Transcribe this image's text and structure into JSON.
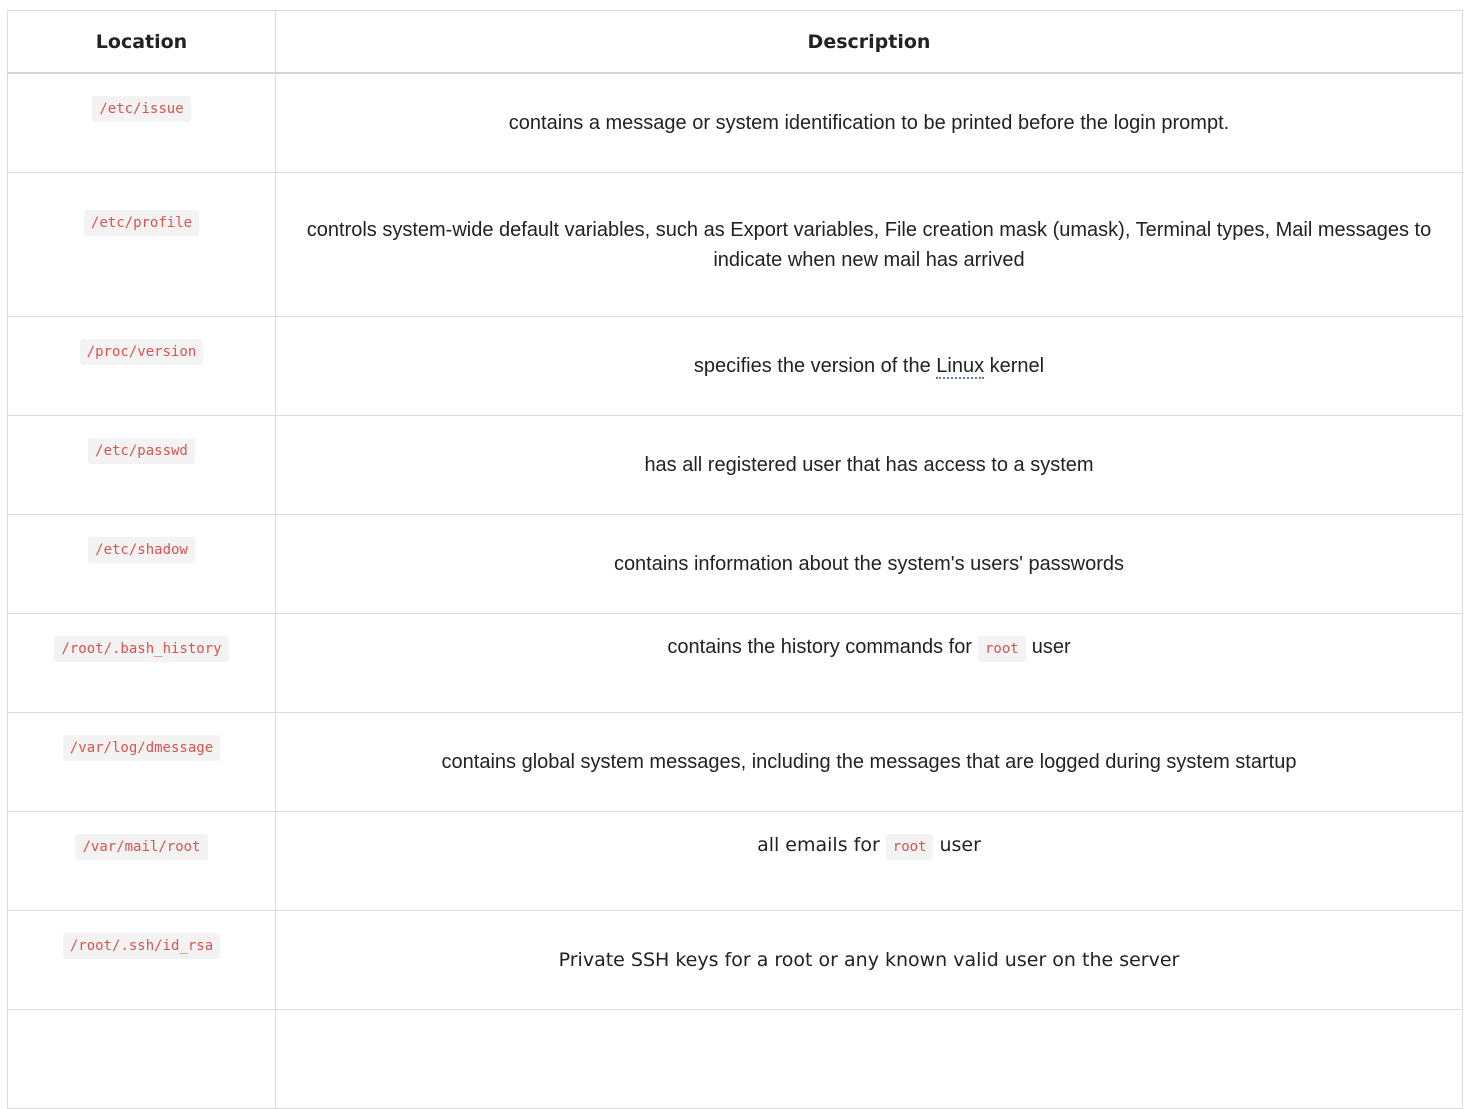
{
  "headers": {
    "location": "Location",
    "description": "Description"
  },
  "rows": [
    {
      "location": "/etc/issue",
      "description": "contains a message or system identification to be printed before the login prompt."
    },
    {
      "location": "/etc/profile",
      "description": "controls system-wide default variables, such as Export variables, File creation mask (umask), Terminal types, Mail messages to indicate when new mail has arrived"
    },
    {
      "location": "/proc/version",
      "desc_before": "specifies the version of the ",
      "desc_link": "Linux",
      "desc_after": " kernel"
    },
    {
      "location": "/etc/passwd",
      "description": "has all registered user that has access to a system"
    },
    {
      "location": "/etc/shadow",
      "description": "contains information about the system's users' passwords"
    },
    {
      "location": "/root/.bash_history",
      "desc_before": "contains the history commands for",
      "desc_code": "root",
      "desc_after": "user"
    },
    {
      "location": "/var/log/dmessage",
      "description": "contains global system messages, including the messages that are logged during system startup"
    },
    {
      "location": "/var/mail/root",
      "desc_before": "all emails for",
      "desc_code": "root",
      "desc_after": "user"
    },
    {
      "location": "/root/.ssh/id_rsa",
      "description": "Private SSH keys for a root or any known valid user on the server"
    }
  ]
}
